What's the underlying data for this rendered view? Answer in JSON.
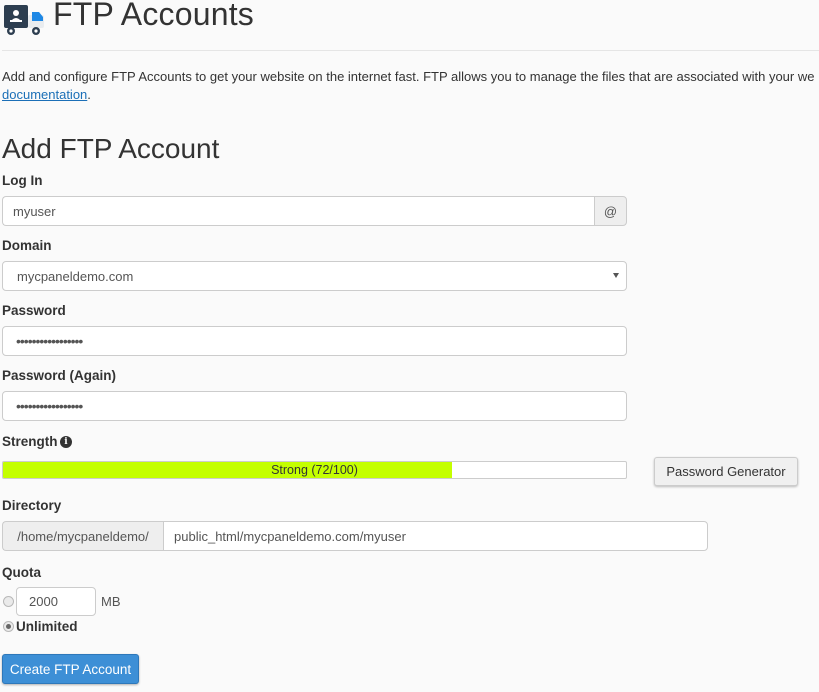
{
  "header": {
    "icon": "ftp-truck-icon",
    "title": "FTP Accounts"
  },
  "description": {
    "text": "Add and configure FTP Accounts to get your website on the internet fast. FTP allows you to manage the files that are associated with your we",
    "link_label": "documentation",
    "suffix": "."
  },
  "form": {
    "title": "Add FTP Account",
    "login": {
      "label": "Log In",
      "value": "myuser",
      "addon": "@"
    },
    "domain": {
      "label": "Domain",
      "selected": "mycpaneldemo.com",
      "icon": "caret-down-icon"
    },
    "password": {
      "label": "Password",
      "masked_value": "•••••••••••••••••"
    },
    "password_again": {
      "label": "Password (Again)",
      "masked_value": "•••••••••••••••••"
    },
    "strength": {
      "label": "Strength",
      "info_icon": "info-icon",
      "score": 72,
      "max": 100,
      "text": "Strong (72/100)",
      "fill_color": "#c4ff00",
      "generator_label": "Password Generator"
    },
    "directory": {
      "label": "Directory",
      "prefix": "/home/mycpaneldemo/",
      "value": "public_html/mycpaneldemo.com/myuser"
    },
    "quota": {
      "label": "Quota",
      "limited_value": "2000",
      "unit": "MB",
      "unlimited_label": "Unlimited",
      "selected": "unlimited"
    },
    "submit_label": "Create FTP Account",
    "colors": {
      "primary": "#3d8fd6",
      "link": "#1b6fb7"
    }
  }
}
